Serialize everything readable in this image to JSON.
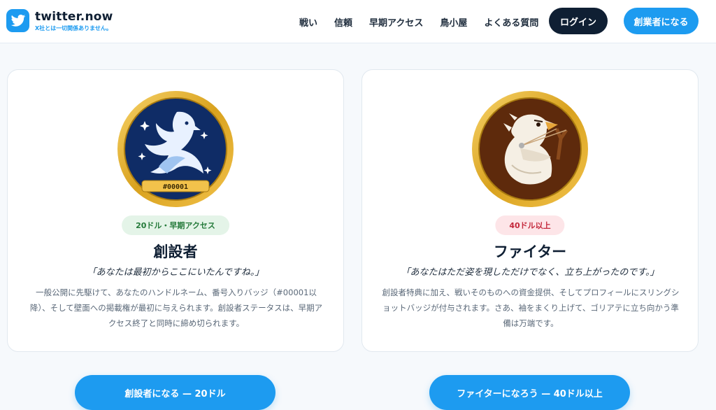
{
  "brand": {
    "name": "twitter.now",
    "tagline": "X社とは一切関係ありません。",
    "logo_icon": "bird-icon",
    "accent": "#1d9bf0"
  },
  "nav": {
    "links": [
      "戦い",
      "信頼",
      "早期アクセス",
      "鳥小屋",
      "よくある質問"
    ],
    "login_label": "ログイン",
    "cta_label": "創業者になる"
  },
  "cards": [
    {
      "badge_icon": "phoenix-medal-icon",
      "badge_number": "#00001",
      "pill": "20ドル・早期アクセス",
      "title": "創設者",
      "quote": "「あなたは最初からここにいたんですね。」",
      "description": "一般公開に先駆けて、あなたのハンドルネーム、番号入りバッジ（#00001以降）、そして壁面への掲載権が最初に与えられます。創設者ステータスは、早期アクセス終了と同時に締め切られます。",
      "button_label": "創設者になる — 20ドル",
      "colors": {
        "medal": "#0f2c66",
        "pill_bg": "#e4f4e8",
        "pill_text": "#247a3a"
      }
    },
    {
      "badge_icon": "slingshot-bird-medal-icon",
      "pill": "40ドル以上",
      "title": "ファイター",
      "quote": "「あなたはただ姿を現しただけでなく、立ち上がったのです。」",
      "description": "創設者特典に加え、戦いそのものへの資金提供、そしてプロフィールにスリングショットバッジが付与されます。さあ、袖をまくり上げて、ゴリアテに立ち向かう準備は万端です。",
      "button_label": "ファイターになろう — 40ドル以上",
      "colors": {
        "medal": "#5e2a0c",
        "pill_bg": "#fde5e8",
        "pill_text": "#c4283b"
      }
    }
  ]
}
